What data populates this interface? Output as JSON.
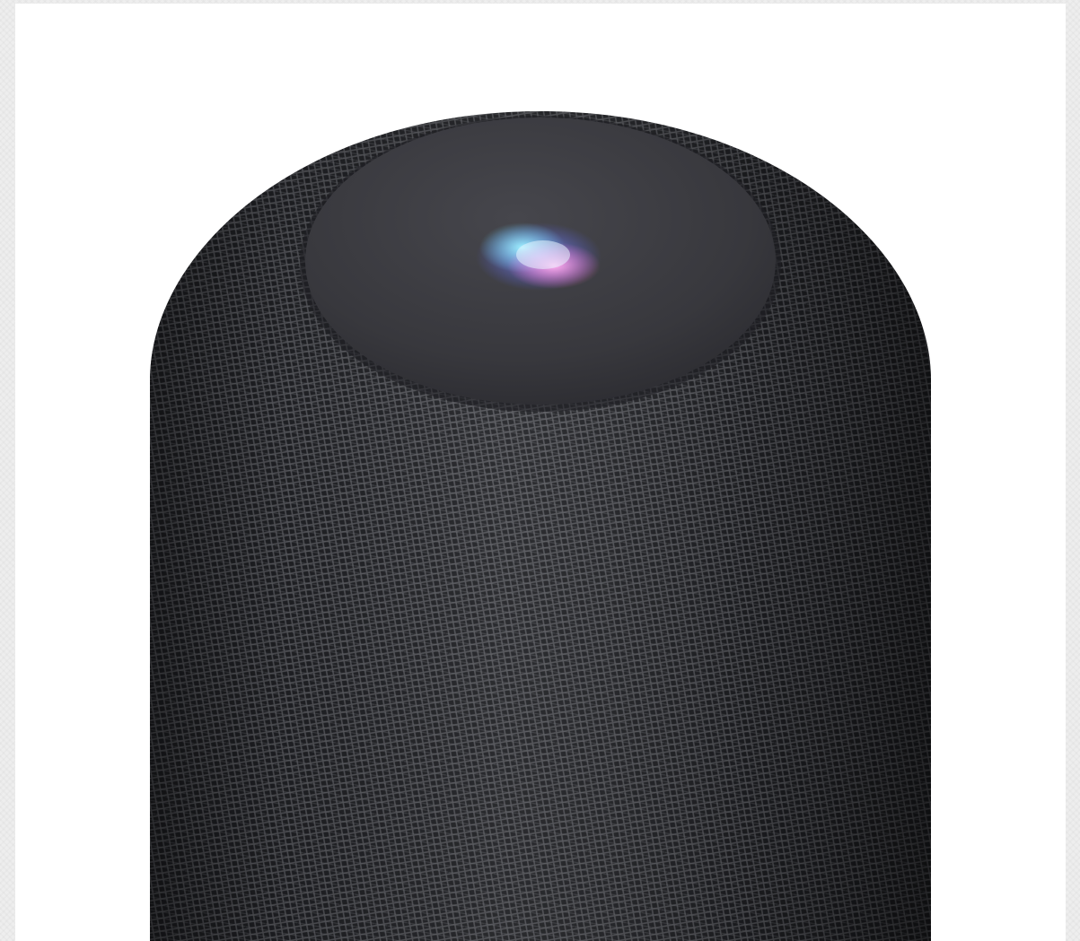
{
  "image": {
    "subject_icon": "smart-speaker-icon",
    "colors": {
      "page_background": "#eeeeee",
      "card_background": "#ffffff",
      "speaker_body": "#2a2b2f",
      "speaker_mesh": "#5a5b60",
      "top_panel": "#3a3a3f",
      "glow_cyan": "#7fe6ff",
      "glow_blue": "#6f7dff",
      "glow_pink": "#ff7fe0"
    }
  }
}
